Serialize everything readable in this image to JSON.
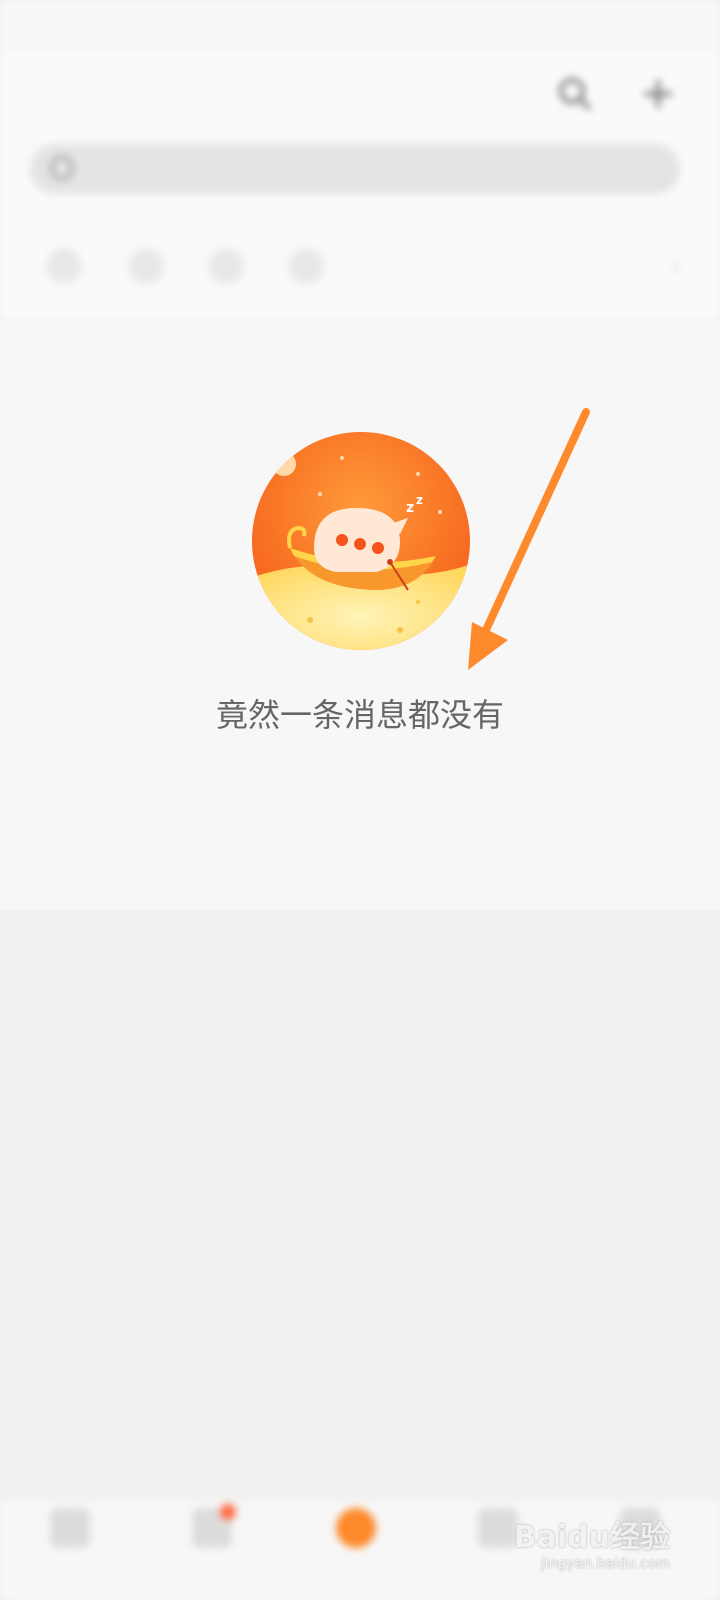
{
  "status_bar": {
    "left_text": "",
    "right_text": ""
  },
  "header": {
    "title": "",
    "read_all_label": "",
    "search_placeholder": ""
  },
  "empty_state": {
    "message": "竟然一条消息都没有"
  },
  "tab_bar": {
    "tabs": [
      {
        "label": "",
        "active": false
      },
      {
        "label": "",
        "active": false
      },
      {
        "label": "",
        "active": true
      },
      {
        "label": "",
        "active": false
      },
      {
        "label": "",
        "active": false
      }
    ]
  },
  "watermark": {
    "brand": "Baidu经验",
    "url": "jingyan.baidu.com"
  },
  "colors": {
    "accent": "#ff8a2b",
    "annotation_arrow": "#ff8a2b",
    "illustration_sky": "#ff6a1f",
    "illustration_sand": "#ffe27a"
  }
}
